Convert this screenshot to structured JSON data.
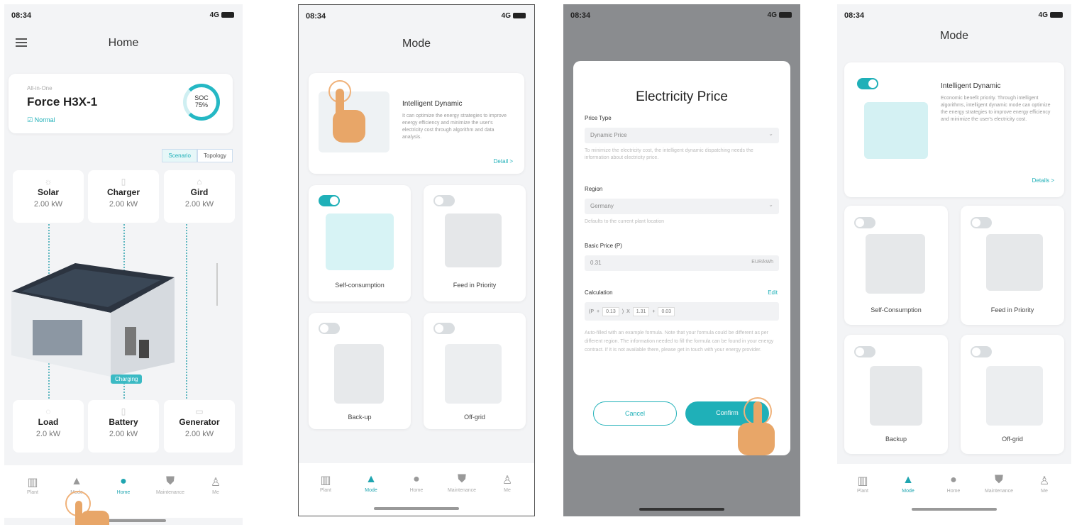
{
  "status": {
    "time": "08:34",
    "network": "4G"
  },
  "screen1": {
    "title": "Home",
    "device": {
      "small_label": "All-in-One",
      "name": "Force H3X-1",
      "status": "Normal",
      "soc_label": "SOC",
      "soc_value": "75%"
    },
    "segment": [
      "Scenario",
      "Topology"
    ],
    "tiles_top": [
      {
        "name": "Solar",
        "value": "2.00 kW"
      },
      {
        "name": "Charger",
        "value": "2.00 kW"
      },
      {
        "name": "Gird",
        "value": "2.00 kW"
      }
    ],
    "charging_label": "Charging",
    "tiles_bottom": [
      {
        "name": "Load",
        "value": "2.0 kW"
      },
      {
        "name": "Battery",
        "value": "2.00 kW"
      },
      {
        "name": "Generator",
        "value": "2.00 kW"
      }
    ],
    "tabs": [
      "Plant",
      "Mode",
      "Home",
      "Maintenance",
      "Me"
    ]
  },
  "screen2": {
    "title": "Mode",
    "intelligent": {
      "title": "Intelligent Dynamic",
      "desc": "It can optimize the energy strategies to improve energy efficiency and minimize the user's electricity cost through algorithm and data analysis.",
      "detail": "Detail >"
    },
    "modes": [
      "Self-consumption",
      "Feed in Priority",
      "Back-up",
      "Off-grid"
    ],
    "tabs": [
      "Plant",
      "Mode",
      "Home",
      "Maintenance",
      "Me"
    ]
  },
  "screen3": {
    "dialog_title": "Electricity Price",
    "price_type_label": "Price Type",
    "price_type_value": "Dynamic Price",
    "price_type_hint": "To minimize the electricity cost, the intelligent dynamic dispatching needs the information about electricity price.",
    "region_label": "Region",
    "region_value": "Germany",
    "region_hint": "Defaults to the current plant location",
    "basic_price_label": "Basic Price (P)",
    "basic_price_value": "0.31",
    "basic_price_unit": "EUR/kWh",
    "calculation_label": "Calculation",
    "edit": "Edit",
    "calc_parts": [
      "(P",
      "+",
      "0.13",
      ")",
      "X",
      "1.31",
      "+",
      "0.03"
    ],
    "calc_hint": "Auto-filled with an example formula. Note that your formula could be different as per different region. The information needed to fill the formula can be found in your energy contract. If it is not available there, please get in touch with your energy provider.",
    "cancel": "Cancel",
    "confirm": "Confirm"
  },
  "screen4": {
    "title": "Mode",
    "intelligent": {
      "title": "Intelligent Dynamic",
      "desc": "Economic benefit priority. Through intelligent algorithms, intelligent dynamic mode can optimize the energy strategies to improve energy efficiency and minimize the user's electricity cost.",
      "detail": "Details >"
    },
    "modes": [
      "Self-Consumption",
      "Feed in Priority",
      "Backup",
      "Off-grid"
    ],
    "tabs": [
      "Plant",
      "Mode",
      "Home",
      "Maintenance",
      "Me"
    ]
  },
  "colors": {
    "accent": "#1fb0b8",
    "tap": "#f0b27a"
  }
}
